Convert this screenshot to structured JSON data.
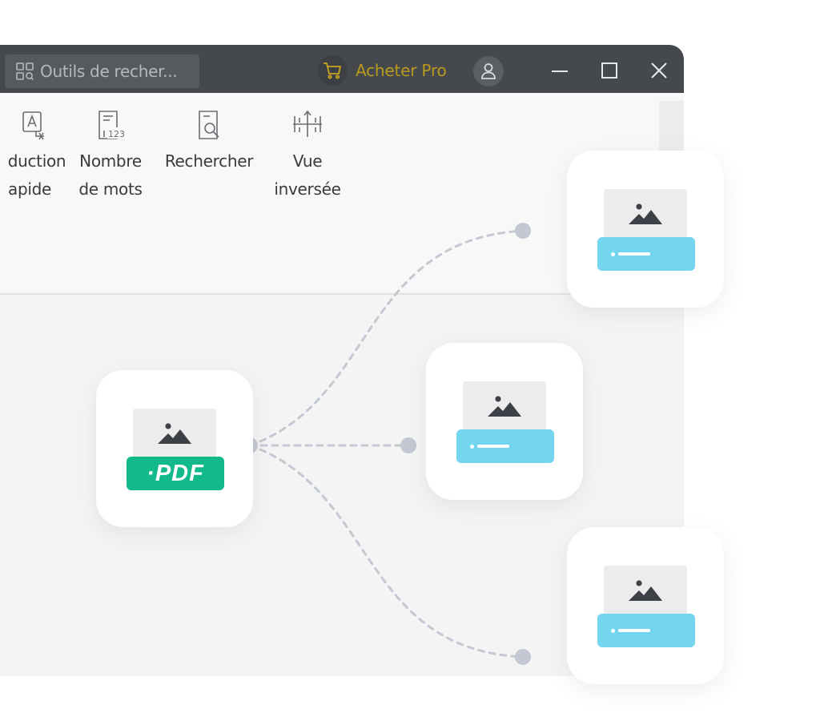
{
  "titlebar": {
    "search_placeholder": "Outils de recher...",
    "buy_pro_label": "Acheter Pro"
  },
  "ribbon": {
    "tools": [
      {
        "line1": "duction",
        "line2": "apide",
        "icon": "translate-icon"
      },
      {
        "line1": "Nombre",
        "line2": "de mots",
        "icon": "word-count-icon"
      },
      {
        "line1": "Rechercher",
        "line2": "",
        "icon": "search-document-icon"
      },
      {
        "line1": "Vue",
        "line2": "inversée",
        "icon": "reverse-view-icon"
      }
    ]
  },
  "illustration": {
    "source_label": "·PDF",
    "colors": {
      "pdf_green": "#12b98a",
      "image_tag_blue": "#74d6ee",
      "connector_gray": "#c3c8d2"
    }
  }
}
